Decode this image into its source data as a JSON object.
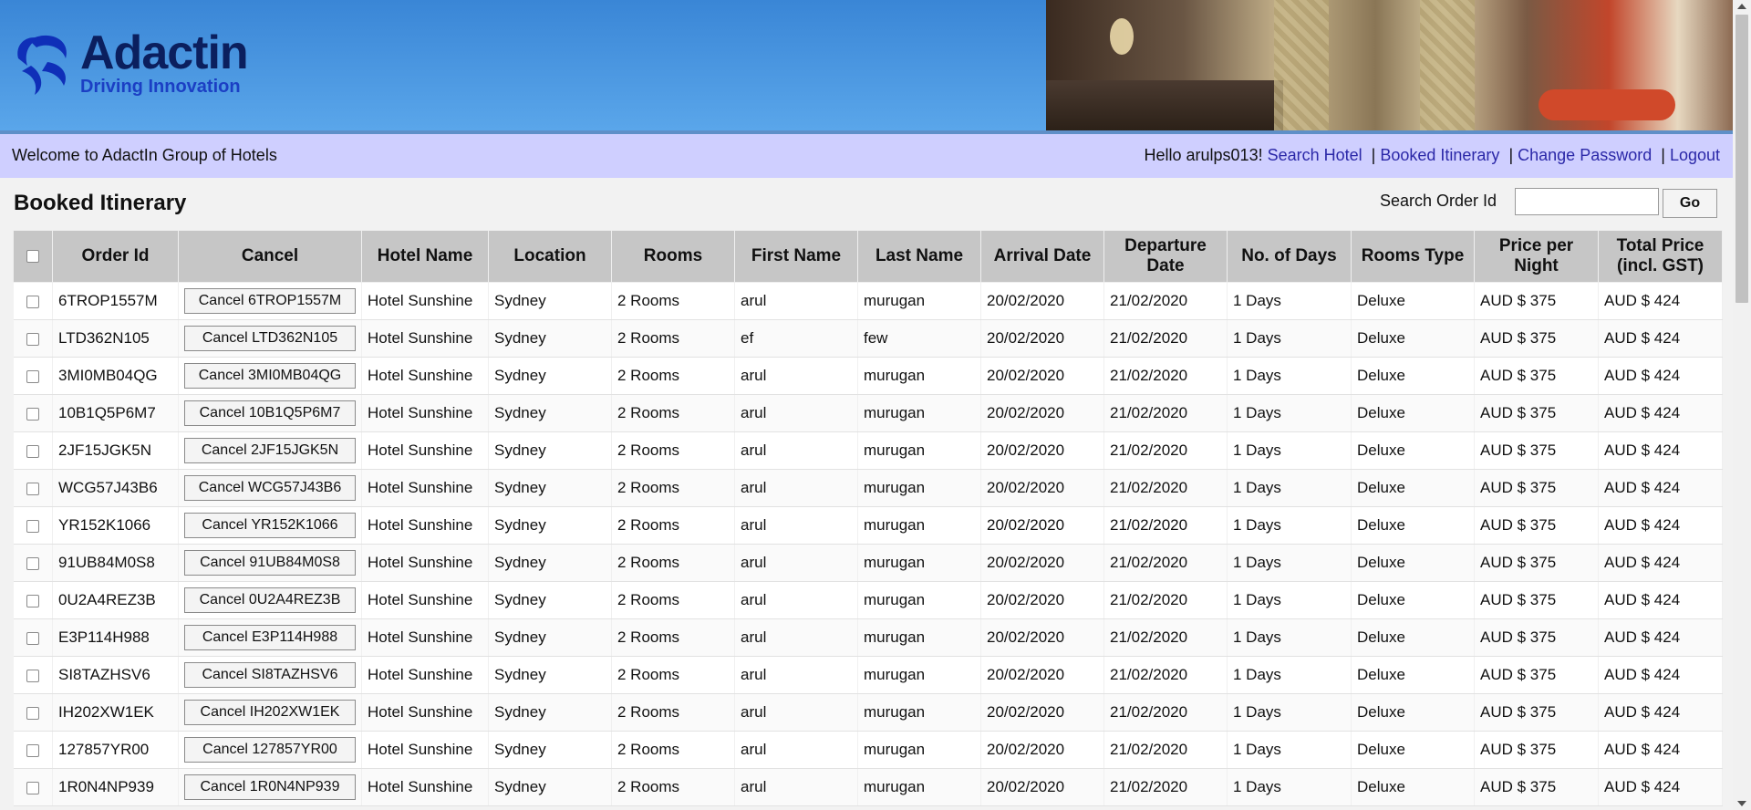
{
  "brand": {
    "name": "Adactin",
    "tagline": "Driving Innovation"
  },
  "welcome": {
    "text": "Welcome to AdactIn Group of Hotels",
    "greeting": "Hello arulps013!",
    "links": {
      "search": "Search Hotel",
      "booked": "Booked Itinerary",
      "password": "Change Password",
      "logout": "Logout"
    },
    "separator": "|"
  },
  "page": {
    "title": "Booked Itinerary"
  },
  "search": {
    "label": "Search Order Id",
    "value": "",
    "go_label": "Go"
  },
  "table": {
    "headers": {
      "order_id": "Order Id",
      "cancel": "Cancel",
      "hotel": "Hotel Name",
      "location": "Location",
      "rooms": "Rooms",
      "first": "First Name",
      "last": "Last Name",
      "arrival": "Arrival Date",
      "departure": "Departure Date",
      "days": "No. of Days",
      "type": "Rooms Type",
      "price": "Price per Night",
      "total": "Total Price (incl. GST)"
    },
    "rows": [
      {
        "order_id": "6TROP1557M",
        "cancel": "Cancel 6TROP1557M",
        "hotel": "Hotel Sunshine",
        "location": "Sydney",
        "rooms": "2 Rooms",
        "first": "arul",
        "last": "murugan",
        "arrival": "20/02/2020",
        "departure": "21/02/2020",
        "days": "1 Days",
        "type": "Deluxe",
        "price": "AUD $ 375",
        "total": "AUD $ 424"
      },
      {
        "order_id": "LTD362N105",
        "cancel": "Cancel LTD362N105",
        "hotel": "Hotel Sunshine",
        "location": "Sydney",
        "rooms": "2 Rooms",
        "first": "ef",
        "last": "few",
        "arrival": "20/02/2020",
        "departure": "21/02/2020",
        "days": "1 Days",
        "type": "Deluxe",
        "price": "AUD $ 375",
        "total": "AUD $ 424"
      },
      {
        "order_id": "3MI0MB04QG",
        "cancel": "Cancel 3MI0MB04QG",
        "hotel": "Hotel Sunshine",
        "location": "Sydney",
        "rooms": "2 Rooms",
        "first": "arul",
        "last": "murugan",
        "arrival": "20/02/2020",
        "departure": "21/02/2020",
        "days": "1 Days",
        "type": "Deluxe",
        "price": "AUD $ 375",
        "total": "AUD $ 424"
      },
      {
        "order_id": "10B1Q5P6M7",
        "cancel": "Cancel 10B1Q5P6M7",
        "hotel": "Hotel Sunshine",
        "location": "Sydney",
        "rooms": "2 Rooms",
        "first": "arul",
        "last": "murugan",
        "arrival": "20/02/2020",
        "departure": "21/02/2020",
        "days": "1 Days",
        "type": "Deluxe",
        "price": "AUD $ 375",
        "total": "AUD $ 424"
      },
      {
        "order_id": "2JF15JGK5N",
        "cancel": "Cancel 2JF15JGK5N",
        "hotel": "Hotel Sunshine",
        "location": "Sydney",
        "rooms": "2 Rooms",
        "first": "arul",
        "last": "murugan",
        "arrival": "20/02/2020",
        "departure": "21/02/2020",
        "days": "1 Days",
        "type": "Deluxe",
        "price": "AUD $ 375",
        "total": "AUD $ 424"
      },
      {
        "order_id": "WCG57J43B6",
        "cancel": "Cancel WCG57J43B6",
        "hotel": "Hotel Sunshine",
        "location": "Sydney",
        "rooms": "2 Rooms",
        "first": "arul",
        "last": "murugan",
        "arrival": "20/02/2020",
        "departure": "21/02/2020",
        "days": "1 Days",
        "type": "Deluxe",
        "price": "AUD $ 375",
        "total": "AUD $ 424"
      },
      {
        "order_id": "YR152K1066",
        "cancel": "Cancel YR152K1066",
        "hotel": "Hotel Sunshine",
        "location": "Sydney",
        "rooms": "2 Rooms",
        "first": "arul",
        "last": "murugan",
        "arrival": "20/02/2020",
        "departure": "21/02/2020",
        "days": "1 Days",
        "type": "Deluxe",
        "price": "AUD $ 375",
        "total": "AUD $ 424"
      },
      {
        "order_id": "91UB84M0S8",
        "cancel": "Cancel 91UB84M0S8",
        "hotel": "Hotel Sunshine",
        "location": "Sydney",
        "rooms": "2 Rooms",
        "first": "arul",
        "last": "murugan",
        "arrival": "20/02/2020",
        "departure": "21/02/2020",
        "days": "1 Days",
        "type": "Deluxe",
        "price": "AUD $ 375",
        "total": "AUD $ 424"
      },
      {
        "order_id": "0U2A4REZ3B",
        "cancel": "Cancel 0U2A4REZ3B",
        "hotel": "Hotel Sunshine",
        "location": "Sydney",
        "rooms": "2 Rooms",
        "first": "arul",
        "last": "murugan",
        "arrival": "20/02/2020",
        "departure": "21/02/2020",
        "days": "1 Days",
        "type": "Deluxe",
        "price": "AUD $ 375",
        "total": "AUD $ 424"
      },
      {
        "order_id": "E3P114H988",
        "cancel": "Cancel E3P114H988",
        "hotel": "Hotel Sunshine",
        "location": "Sydney",
        "rooms": "2 Rooms",
        "first": "arul",
        "last": "murugan",
        "arrival": "20/02/2020",
        "departure": "21/02/2020",
        "days": "1 Days",
        "type": "Deluxe",
        "price": "AUD $ 375",
        "total": "AUD $ 424"
      },
      {
        "order_id": "SI8TAZHSV6",
        "cancel": "Cancel SI8TAZHSV6",
        "hotel": "Hotel Sunshine",
        "location": "Sydney",
        "rooms": "2 Rooms",
        "first": "arul",
        "last": "murugan",
        "arrival": "20/02/2020",
        "departure": "21/02/2020",
        "days": "1 Days",
        "type": "Deluxe",
        "price": "AUD $ 375",
        "total": "AUD $ 424"
      },
      {
        "order_id": "IH202XW1EK",
        "cancel": "Cancel IH202XW1EK",
        "hotel": "Hotel Sunshine",
        "location": "Sydney",
        "rooms": "2 Rooms",
        "first": "arul",
        "last": "murugan",
        "arrival": "20/02/2020",
        "departure": "21/02/2020",
        "days": "1 Days",
        "type": "Deluxe",
        "price": "AUD $ 375",
        "total": "AUD $ 424"
      },
      {
        "order_id": "127857YR00",
        "cancel": "Cancel 127857YR00",
        "hotel": "Hotel Sunshine",
        "location": "Sydney",
        "rooms": "2 Rooms",
        "first": "arul",
        "last": "murugan",
        "arrival": "20/02/2020",
        "departure": "21/02/2020",
        "days": "1 Days",
        "type": "Deluxe",
        "price": "AUD $ 375",
        "total": "AUD $ 424"
      },
      {
        "order_id": "1R0N4NP939",
        "cancel": "Cancel 1R0N4NP939",
        "hotel": "Hotel Sunshine",
        "location": "Sydney",
        "rooms": "2 Rooms",
        "first": "arul",
        "last": "murugan",
        "arrival": "20/02/2020",
        "departure": "21/02/2020",
        "days": "1 Days",
        "type": "Deluxe",
        "price": "AUD $ 375",
        "total": "AUD $ 424"
      }
    ]
  },
  "colors": {
    "header_blue": "#3a86d6",
    "welcome_bar": "#cfcfff",
    "link": "#2b28a8",
    "table_header": "#c6c6c6"
  }
}
